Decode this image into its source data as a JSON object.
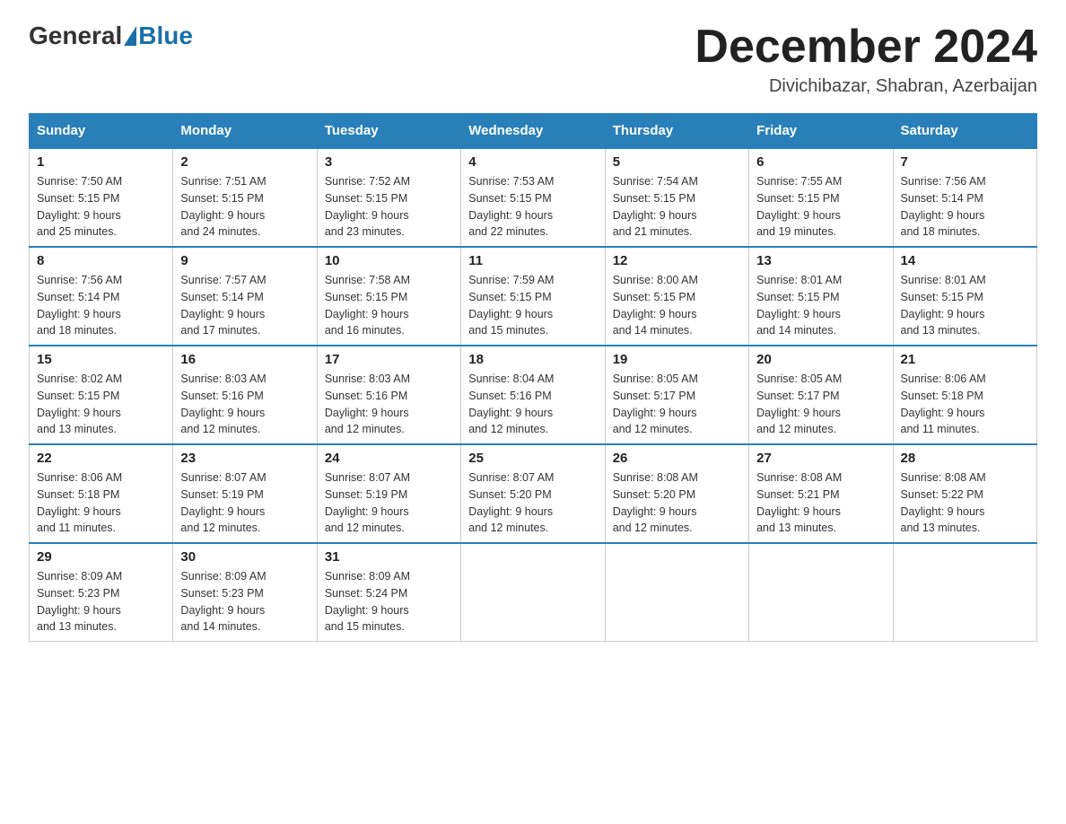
{
  "header": {
    "logo_general": "General",
    "logo_blue": "Blue",
    "month_title": "December 2024",
    "location": "Divichibazar, Shabran, Azerbaijan"
  },
  "weekdays": [
    "Sunday",
    "Monday",
    "Tuesday",
    "Wednesday",
    "Thursday",
    "Friday",
    "Saturday"
  ],
  "weeks": [
    [
      {
        "day": "1",
        "info": "Sunrise: 7:50 AM\nSunset: 5:15 PM\nDaylight: 9 hours\nand 25 minutes."
      },
      {
        "day": "2",
        "info": "Sunrise: 7:51 AM\nSunset: 5:15 PM\nDaylight: 9 hours\nand 24 minutes."
      },
      {
        "day": "3",
        "info": "Sunrise: 7:52 AM\nSunset: 5:15 PM\nDaylight: 9 hours\nand 23 minutes."
      },
      {
        "day": "4",
        "info": "Sunrise: 7:53 AM\nSunset: 5:15 PM\nDaylight: 9 hours\nand 22 minutes."
      },
      {
        "day": "5",
        "info": "Sunrise: 7:54 AM\nSunset: 5:15 PM\nDaylight: 9 hours\nand 21 minutes."
      },
      {
        "day": "6",
        "info": "Sunrise: 7:55 AM\nSunset: 5:15 PM\nDaylight: 9 hours\nand 19 minutes."
      },
      {
        "day": "7",
        "info": "Sunrise: 7:56 AM\nSunset: 5:14 PM\nDaylight: 9 hours\nand 18 minutes."
      }
    ],
    [
      {
        "day": "8",
        "info": "Sunrise: 7:56 AM\nSunset: 5:14 PM\nDaylight: 9 hours\nand 18 minutes."
      },
      {
        "day": "9",
        "info": "Sunrise: 7:57 AM\nSunset: 5:14 PM\nDaylight: 9 hours\nand 17 minutes."
      },
      {
        "day": "10",
        "info": "Sunrise: 7:58 AM\nSunset: 5:15 PM\nDaylight: 9 hours\nand 16 minutes."
      },
      {
        "day": "11",
        "info": "Sunrise: 7:59 AM\nSunset: 5:15 PM\nDaylight: 9 hours\nand 15 minutes."
      },
      {
        "day": "12",
        "info": "Sunrise: 8:00 AM\nSunset: 5:15 PM\nDaylight: 9 hours\nand 14 minutes."
      },
      {
        "day": "13",
        "info": "Sunrise: 8:01 AM\nSunset: 5:15 PM\nDaylight: 9 hours\nand 14 minutes."
      },
      {
        "day": "14",
        "info": "Sunrise: 8:01 AM\nSunset: 5:15 PM\nDaylight: 9 hours\nand 13 minutes."
      }
    ],
    [
      {
        "day": "15",
        "info": "Sunrise: 8:02 AM\nSunset: 5:15 PM\nDaylight: 9 hours\nand 13 minutes."
      },
      {
        "day": "16",
        "info": "Sunrise: 8:03 AM\nSunset: 5:16 PM\nDaylight: 9 hours\nand 12 minutes."
      },
      {
        "day": "17",
        "info": "Sunrise: 8:03 AM\nSunset: 5:16 PM\nDaylight: 9 hours\nand 12 minutes."
      },
      {
        "day": "18",
        "info": "Sunrise: 8:04 AM\nSunset: 5:16 PM\nDaylight: 9 hours\nand 12 minutes."
      },
      {
        "day": "19",
        "info": "Sunrise: 8:05 AM\nSunset: 5:17 PM\nDaylight: 9 hours\nand 12 minutes."
      },
      {
        "day": "20",
        "info": "Sunrise: 8:05 AM\nSunset: 5:17 PM\nDaylight: 9 hours\nand 12 minutes."
      },
      {
        "day": "21",
        "info": "Sunrise: 8:06 AM\nSunset: 5:18 PM\nDaylight: 9 hours\nand 11 minutes."
      }
    ],
    [
      {
        "day": "22",
        "info": "Sunrise: 8:06 AM\nSunset: 5:18 PM\nDaylight: 9 hours\nand 11 minutes."
      },
      {
        "day": "23",
        "info": "Sunrise: 8:07 AM\nSunset: 5:19 PM\nDaylight: 9 hours\nand 12 minutes."
      },
      {
        "day": "24",
        "info": "Sunrise: 8:07 AM\nSunset: 5:19 PM\nDaylight: 9 hours\nand 12 minutes."
      },
      {
        "day": "25",
        "info": "Sunrise: 8:07 AM\nSunset: 5:20 PM\nDaylight: 9 hours\nand 12 minutes."
      },
      {
        "day": "26",
        "info": "Sunrise: 8:08 AM\nSunset: 5:20 PM\nDaylight: 9 hours\nand 12 minutes."
      },
      {
        "day": "27",
        "info": "Sunrise: 8:08 AM\nSunset: 5:21 PM\nDaylight: 9 hours\nand 13 minutes."
      },
      {
        "day": "28",
        "info": "Sunrise: 8:08 AM\nSunset: 5:22 PM\nDaylight: 9 hours\nand 13 minutes."
      }
    ],
    [
      {
        "day": "29",
        "info": "Sunrise: 8:09 AM\nSunset: 5:23 PM\nDaylight: 9 hours\nand 13 minutes."
      },
      {
        "day": "30",
        "info": "Sunrise: 8:09 AM\nSunset: 5:23 PM\nDaylight: 9 hours\nand 14 minutes."
      },
      {
        "day": "31",
        "info": "Sunrise: 8:09 AM\nSunset: 5:24 PM\nDaylight: 9 hours\nand 15 minutes."
      },
      {
        "day": "",
        "info": ""
      },
      {
        "day": "",
        "info": ""
      },
      {
        "day": "",
        "info": ""
      },
      {
        "day": "",
        "info": ""
      }
    ]
  ]
}
